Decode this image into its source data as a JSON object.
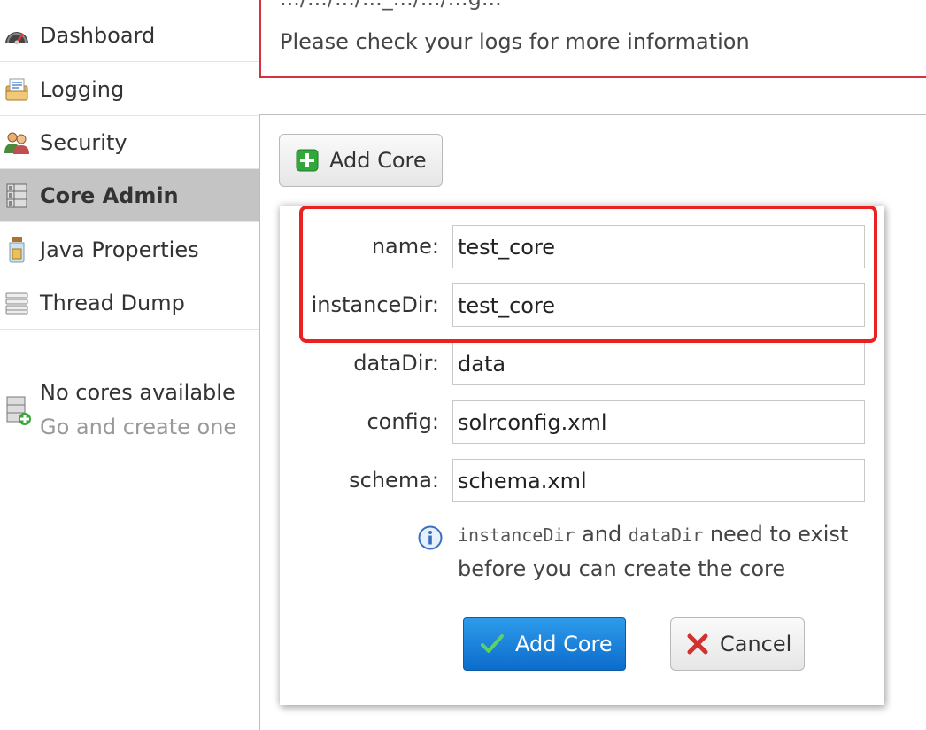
{
  "sidebar": {
    "items": [
      {
        "label": "Dashboard",
        "icon": "speedometer-icon",
        "active": false
      },
      {
        "label": "Logging",
        "icon": "logging-icon",
        "active": false
      },
      {
        "label": "Security",
        "icon": "users-icon",
        "active": false
      },
      {
        "label": "Core Admin",
        "icon": "database-icon",
        "active": true
      },
      {
        "label": "Java Properties",
        "icon": "jar-icon",
        "active": false
      },
      {
        "label": "Thread Dump",
        "icon": "stack-icon",
        "active": false
      }
    ],
    "no_cores": {
      "title": "No cores available",
      "subtitle": "Go and create one",
      "icon": "add-server-icon"
    }
  },
  "error": {
    "message": "Please check your logs for more information",
    "partial_line": ".../.../.../..._.../.../...g..."
  },
  "toolbar": {
    "add_core_label": "Add Core"
  },
  "dialog": {
    "fields": [
      {
        "label": "name:",
        "value": "test_core"
      },
      {
        "label": "instanceDir:",
        "value": "test_core"
      },
      {
        "label": "dataDir:",
        "value": "data"
      },
      {
        "label": "config:",
        "value": "solrconfig.xml"
      },
      {
        "label": "schema:",
        "value": "schema.xml"
      }
    ],
    "note": {
      "code1": "instanceDir",
      "and": "and",
      "code2": "dataDir",
      "rest": "need to exist before you can create the core"
    },
    "submit_label": "Add Core",
    "cancel_label": "Cancel"
  },
  "colors": {
    "highlight": "#ea2121",
    "error_border": "#d7323c",
    "primary_button": "#0b6ccc",
    "active_nav": "#c4c4c4"
  }
}
